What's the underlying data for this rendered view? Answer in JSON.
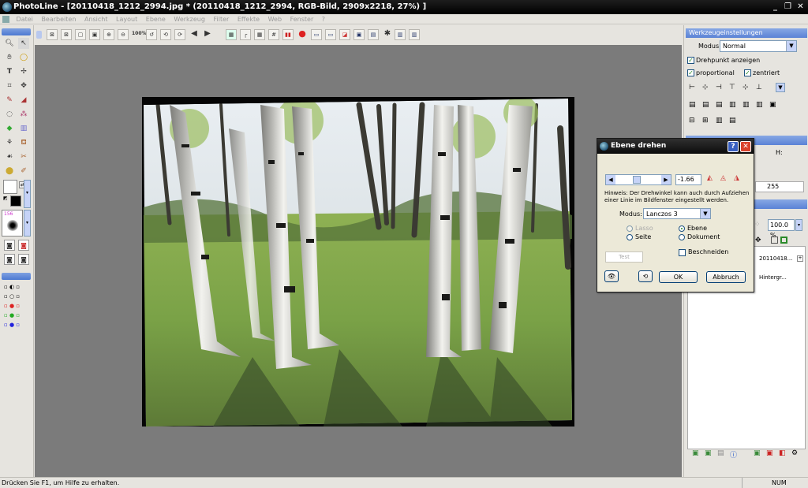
{
  "window": {
    "app_name": "PhotoLine",
    "title": "PhotoLine - [20110418_1212_2994.jpg * (20110418_1212_2994, RGB-Bild, 2909x2218, 27%) ]",
    "controls": [
      "_",
      "❐",
      "✕"
    ]
  },
  "menu": [
    "Datei",
    "Bearbeiten",
    "Ansicht",
    "Layout",
    "Ebene",
    "Werkzeug",
    "Filter",
    "Effekte",
    "Web",
    "Fenster",
    "?"
  ],
  "toolbar": {
    "zoom_100_label": "100%"
  },
  "left_panel": {
    "brush_size": "156"
  },
  "right_panel": {
    "header": "Werkzeugeinstellungen",
    "modus_label": "Modus:",
    "modus_value": "Normal",
    "drehpunkt_label": "Drehpunkt anzeigen",
    "proportional_label": "proportional",
    "zentriert_label": "zentriert",
    "h_label": "H:",
    "value_255": "255",
    "zoom_value": "100.0 %",
    "layers": [
      {
        "name": "20110418..."
      },
      {
        "name": "Hintergr..."
      }
    ]
  },
  "dialog": {
    "title": "Ebene drehen",
    "angle_value": "-1.66",
    "hint": "Hinweis: Der Drehwinkel kann auch durch Aufziehen einer Linie im Bildfenster eingestellt werden.",
    "modus_label": "Modus:",
    "modus_value": "Lanczos 3",
    "radio_lasso": "Lasso",
    "radio_seite": "Seite",
    "radio_ebene": "Ebene",
    "radio_dokument": "Dokument",
    "beschneiden_label": "Beschneiden",
    "test_label": "Test",
    "ok_label": "OK",
    "cancel_label": "Abbruch"
  },
  "status": {
    "hint": "Drücken Sie F1, um Hilfe zu erhalten.",
    "num": "NUM"
  },
  "colors": {
    "title_bg": "#0a0a0a",
    "panel_header": "#5a82d6",
    "canvas_bg": "#7b7b7b",
    "dialog_bg": "#ece9d8",
    "close_red": "#d9422b"
  }
}
